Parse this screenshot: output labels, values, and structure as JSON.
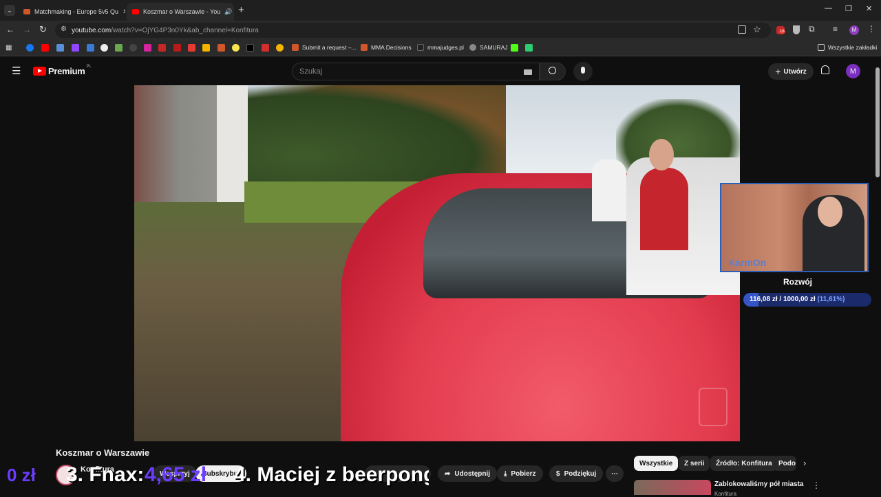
{
  "browser": {
    "tabs": [
      {
        "title": "Matchmaking - Europe 5v5 Qu",
        "active": false
      },
      {
        "title": "Koszmar o Warszawie - You",
        "active": true
      }
    ],
    "url_main": "youtube.com",
    "url_rest": "/watch?v=OjYG4P3n0Yk&ab_channel=Konfitura",
    "extension_badge": "18",
    "profile_initial": "M",
    "bookmarks": [
      "Submit a request –...",
      "MMA Decisions",
      "mmajudges.pl",
      "SAMURAJ"
    ],
    "all_bookmarks": "Wszystkie zakładki"
  },
  "youtube": {
    "logo_text": "Premium",
    "logo_region": "PL",
    "search_placeholder": "Szukaj",
    "create_label": "Utwórz",
    "avatar_initial": "M"
  },
  "video": {
    "title": "Koszmar o Warszawie",
    "channel": "Konfitura",
    "join_label": "Wesprzyj",
    "subscribe_label": "Subskrybuj",
    "actions": {
      "share": "Udostępnij",
      "download": "Pobierz",
      "thanks": "Podziękuj"
    }
  },
  "stream_overlay": {
    "streamer_tag": "KarmOn",
    "goal_title": "Rozwój",
    "goal_current": "116,08 zł",
    "goal_separator": "/",
    "goal_target": "1000,00 zł",
    "goal_percent": "(11,61%)",
    "goal_fraction": 0.1161,
    "ticker_left": "0 zł",
    "ticker_entry_3": "3. Fnax:",
    "ticker_amount_3": "4,65 zł",
    "ticker_entry_4": "4. Maciej z beerpong"
  },
  "sidebar": {
    "chips": [
      "Wszystkie",
      "Z serii",
      "Źródło: Konfitura",
      "Podo"
    ],
    "recommendations": [
      {
        "title": "Zablokowaliśmy pół miasta",
        "channel": "Konfitura"
      }
    ]
  },
  "colors": {
    "accent_red": "#ff0000",
    "overlay_purple": "#6b3cff",
    "overlay_blue": "#2d5fb8"
  }
}
